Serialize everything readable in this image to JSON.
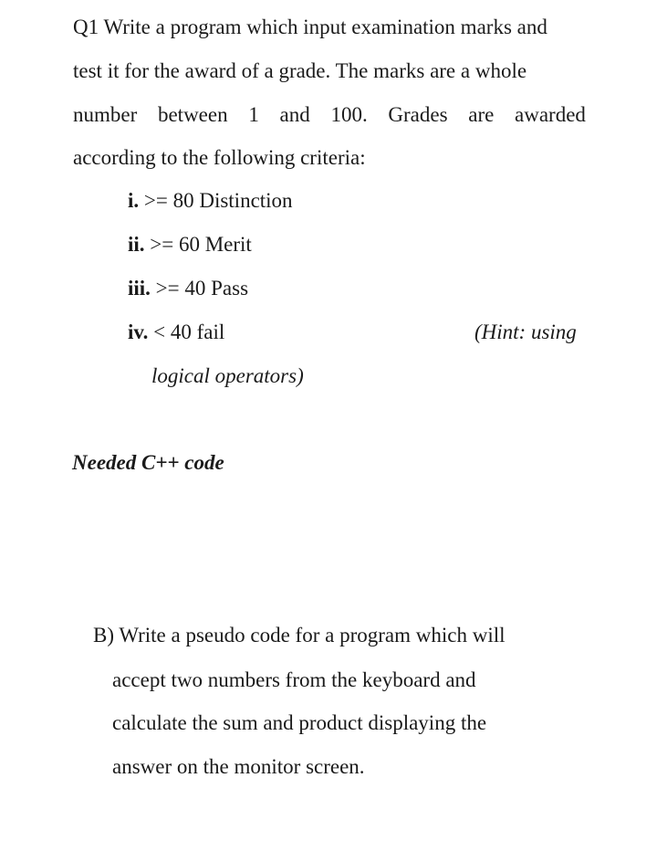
{
  "question1": {
    "paragraph_lines": [
      "Q1 Write a program which input examination marks and",
      "test it for the award of a grade. The marks are a whole",
      "number between 1 and 100. Grades are awarded",
      "according to the following criteria:"
    ],
    "line3_words": [
      "number",
      "between",
      "1",
      "and",
      "100.",
      "Grades",
      "are",
      "awarded"
    ],
    "criteria": [
      {
        "numeral": "i.",
        "text": " >= 80 Distinction"
      },
      {
        "numeral": "ii.",
        "text": " >= 60 Merit"
      },
      {
        "numeral": "iii.",
        "text": " >= 40 Pass"
      },
      {
        "numeral": "iv.",
        "text": " < 40 fail"
      }
    ],
    "hint_part1": "(Hint: using",
    "hint_part2": "logical operators)",
    "needed_label": "Needed C++ code"
  },
  "questionB": {
    "lines": [
      "B) Write a pseudo code for a program which will",
      "accept two numbers from the keyboard and",
      "calculate the sum and product displaying the",
      "answer on the monitor screen."
    ]
  }
}
